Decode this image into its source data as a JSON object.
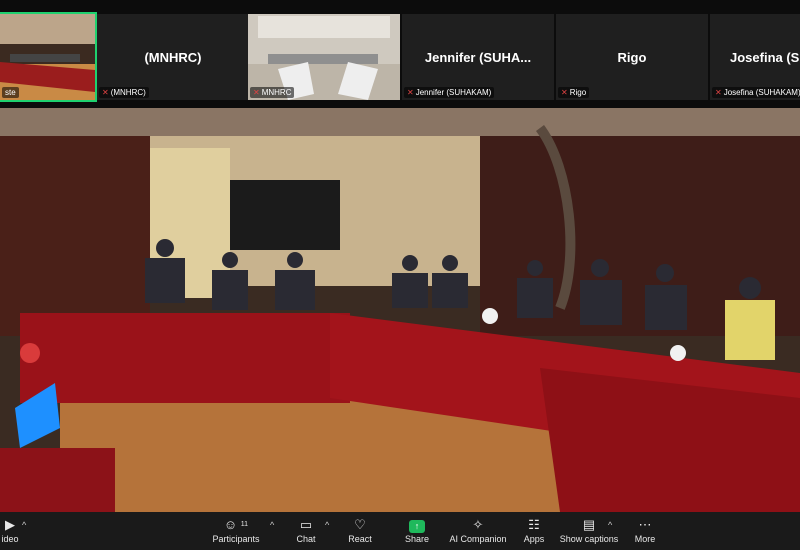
{
  "filmstrip": {
    "tiles": [
      {
        "big": "",
        "tag": "ste"
      },
      {
        "big": "(MNHRC)",
        "tag": "(MNHRC)"
      },
      {
        "big": "",
        "tag": "MNHRC"
      },
      {
        "big": "Jennifer  (SUHA...",
        "tag": "Jennifer (SUHAKAM)"
      },
      {
        "big": "Rigo",
        "tag": "Rigo"
      },
      {
        "big": "Josefina  (SU...",
        "tag": "Josefina (SUHAKAM)"
      }
    ]
  },
  "toolbar": {
    "video": "ideo",
    "participants": "Participants",
    "participants_count": "11",
    "chat": "Chat",
    "react": "React",
    "share": "Share",
    "ai": "AI Companion",
    "apps": "Apps",
    "captions": "Show captions",
    "more": "More"
  },
  "colors": {
    "accent_green": "#1fd16f",
    "table_red": "#a3141b",
    "carpet": "#b5733a"
  }
}
